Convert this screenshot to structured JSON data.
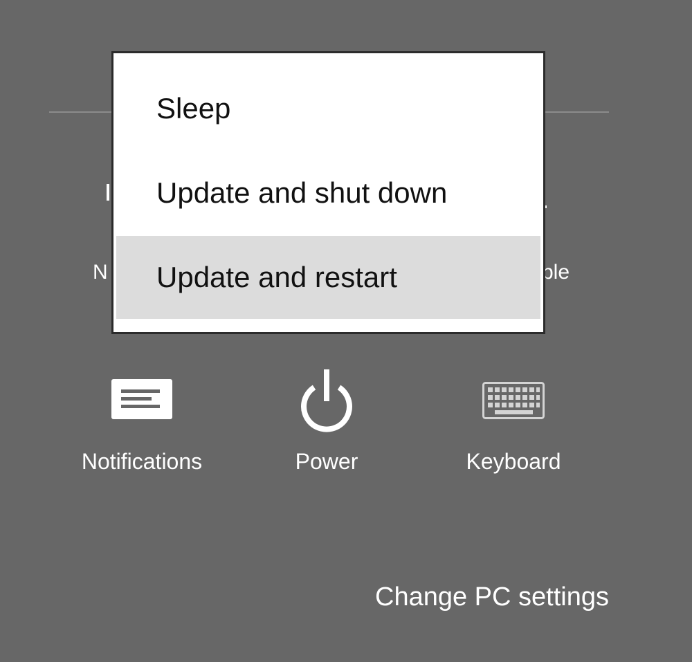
{
  "background_partial_labels": {
    "left": "N",
    "right": "ble"
  },
  "power_menu": {
    "items": [
      {
        "label": "Sleep"
      },
      {
        "label": "Update and shut down"
      },
      {
        "label": "Update and restart",
        "highlighted": true
      }
    ]
  },
  "quick_settings": [
    {
      "label": "Notifications",
      "icon": "notifications-icon"
    },
    {
      "label": "Power",
      "icon": "power-icon"
    },
    {
      "label": "Keyboard",
      "icon": "keyboard-icon"
    }
  ],
  "footer": {
    "change_pc_settings_label": "Change PC settings"
  },
  "colors": {
    "background": "#676767",
    "menu_background": "#ffffff",
    "menu_highlight": "#dcdcdc",
    "menu_border": "#2b2b2b",
    "divider": "#8c8c8c",
    "keyboard_icon": "#d4d4d4"
  }
}
